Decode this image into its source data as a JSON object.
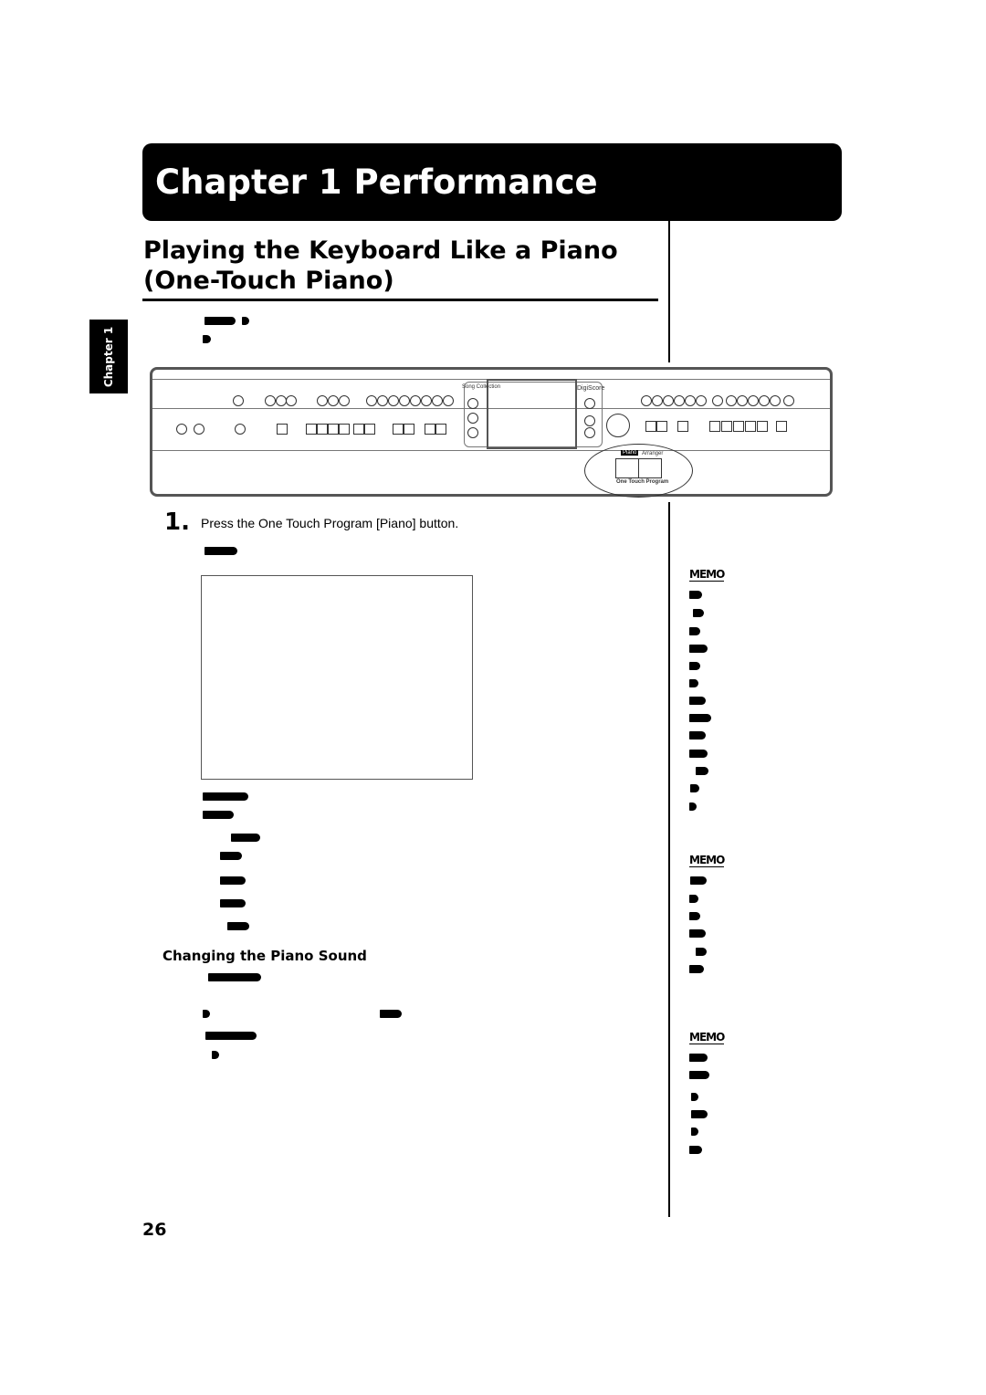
{
  "chapter": {
    "title": "Chapter 1 Performance",
    "side_tab": "Chapter 1"
  },
  "section": {
    "title_line1": "Playing the Keyboard Like a Piano",
    "title_line2": "(One-Touch Piano)"
  },
  "panel": {
    "song_collection": "Song Collection",
    "digiscore": "DigiScore",
    "piano_button": "Piano",
    "arranger_button": "Arranger",
    "one_touch_program": "One Touch Program"
  },
  "step1": {
    "number": "1.",
    "text": "Press the One Touch Program [Piano] button."
  },
  "subheading": "Changing the Piano Sound",
  "memo_label": "MEMO",
  "page_number": "26"
}
